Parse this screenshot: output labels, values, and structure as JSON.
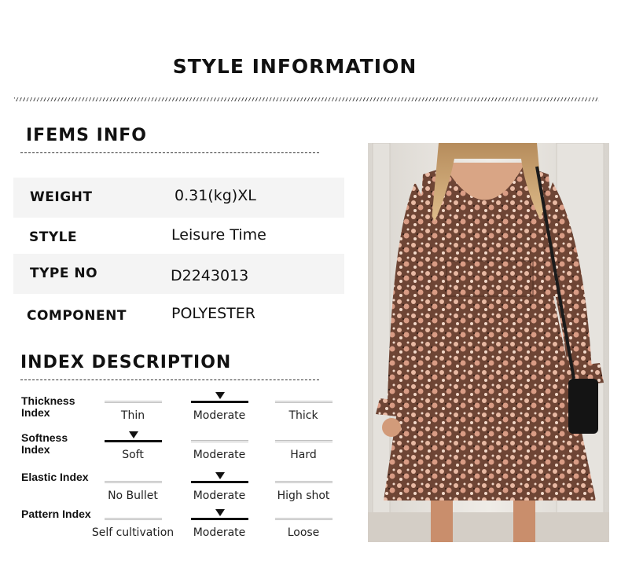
{
  "title": "STYLE INFORMATION",
  "items_section": {
    "title": "IFEMS INFO",
    "rows": [
      {
        "key": "WEIGHT",
        "value": "0.31(kg)XL"
      },
      {
        "key": "STYLE",
        "value": "Leisure Time"
      },
      {
        "key": "TYPE NO",
        "value": "D2243013"
      },
      {
        "key": "COMPONENT",
        "value": "POLYESTER"
      }
    ]
  },
  "index_section": {
    "title": "INDEX DESCRIPTION",
    "indexes": [
      {
        "label": "Thickness Index",
        "options": [
          "Thin",
          "Moderate",
          "Thick"
        ],
        "selected": 1
      },
      {
        "label": "Softness Index",
        "options": [
          "Soft",
          "Moderate",
          "Hard"
        ],
        "selected": 0
      },
      {
        "label": "Elastic Index",
        "options": [
          "No Bullet",
          "Moderate",
          "High shot"
        ],
        "selected": 1
      },
      {
        "label": "Pattern Index",
        "options": [
          "Self cultivation",
          "Moderate",
          "Loose"
        ],
        "selected": 1
      }
    ]
  },
  "product_image": {
    "icon": "model-in-floral-dress-photo"
  }
}
